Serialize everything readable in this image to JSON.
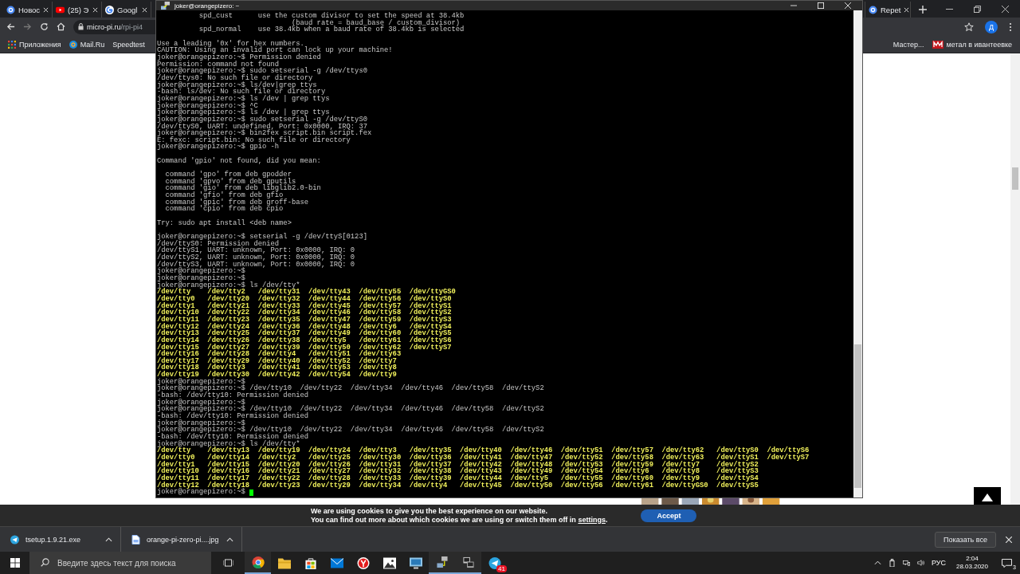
{
  "browser": {
    "tabs": [
      {
        "title": "Новос",
        "selected": false,
        "kind": "site"
      },
      {
        "title": "(25) Э",
        "selected": false,
        "kind": "video"
      },
      {
        "title": "Googl",
        "selected": false,
        "kind": "google"
      },
      {
        "title": "Repet",
        "selected": false,
        "kind": "site"
      }
    ],
    "url": {
      "host": "micro-pi.ru",
      "path": "/rpi-pi4"
    },
    "profile_initial": "Д",
    "bookmarks_left": [
      {
        "label": "Приложения",
        "kind": "apps"
      },
      {
        "label": "Mail.Ru",
        "kind": "mail"
      },
      {
        "label": "Speedtest",
        "kind": "plain"
      }
    ],
    "bookmarks_right": [
      {
        "label": "Мастер...",
        "kind": "plain"
      },
      {
        "label": "метал в ивантеевке",
        "kind": "logo"
      }
    ]
  },
  "cookie_bar": {
    "line1": "We are using cookies to give you the best experience on our website.",
    "line2": "You can find out more about which cookies we are using or switch them off in ",
    "link": "settings",
    "line2_end": ".",
    "button": "Accept"
  },
  "downloads": {
    "items": [
      {
        "name": "tsetup.1.9.21.exe",
        "kind": "telegram"
      },
      {
        "name": "orange-pi-zero-pi....jpg"
      }
    ],
    "show_all": "Показать все"
  },
  "terminal": {
    "title": "joker@orangepizero: ~",
    "cursor": true,
    "lines": [
      {
        "kind": "output",
        "text": "          spd_cust      use the custom divisor to set the speed at 38.4kb"
      },
      {
        "kind": "output",
        "text": "                                (baud rate = baud_base / custom_divisor)"
      },
      {
        "kind": "output",
        "text": "          spd_normal    use 38.4kb when a baud rate of 38.4kb is selected"
      },
      {
        "kind": "blank"
      },
      {
        "kind": "output",
        "text": "Use a leading '0x' for hex numbers."
      },
      {
        "kind": "output",
        "text": "CAUTION: Using an invalid port can lock up your machine!"
      },
      {
        "kind": "output",
        "text": "joker@orangepizero:~$ Permission denied"
      },
      {
        "kind": "output",
        "text": "Permission: command not found"
      },
      {
        "kind": "output",
        "text": "joker@orangepizero:~$ sudo setserial -g /dev/ttys0"
      },
      {
        "kind": "output",
        "text": "/dev/ttys0: No such file or directory"
      },
      {
        "kind": "output",
        "text": "joker@orangepizero:~$ ls/dev|grep ttys"
      },
      {
        "kind": "output",
        "text": "-bash: ls/dev: No such file or directory"
      },
      {
        "kind": "output",
        "text": "joker@orangepizero:~$ ls /dev | grep ttys"
      },
      {
        "kind": "output",
        "text": "joker@orangepizero:~$ ^C"
      },
      {
        "kind": "output",
        "text": "joker@orangepizero:~$ ls /dev | grep ttys"
      },
      {
        "kind": "output",
        "text": "joker@orangepizero:~$ sudo setserial -g /dev/ttyS0"
      },
      {
        "kind": "output",
        "text": "/dev/ttyS0, UART: undefined, Port: 0x0000, IRQ: 37"
      },
      {
        "kind": "output",
        "text": "joker@orangepizero:~$ bin2fex script.bin script.fex"
      },
      {
        "kind": "output",
        "text": "E: fexc: script.bin: No such file or directory"
      },
      {
        "kind": "output",
        "text": "joker@orangepizero:~$ gpio -h"
      },
      {
        "kind": "blank"
      },
      {
        "kind": "output",
        "text": "Command 'gpio' not found, did you mean:"
      },
      {
        "kind": "blank"
      },
      {
        "kind": "output",
        "text": "  command 'gpo' from deb gpodder"
      },
      {
        "kind": "output",
        "text": "  command 'gpvo' from deb gputils"
      },
      {
        "kind": "output",
        "text": "  command 'gio' from deb libglib2.0-bin"
      },
      {
        "kind": "output",
        "text": "  command 'gfio' from deb gfio"
      },
      {
        "kind": "output",
        "text": "  command 'gpic' from deb groff-base"
      },
      {
        "kind": "output",
        "text": "  command 'cpio' from deb cpio"
      },
      {
        "kind": "blank"
      },
      {
        "kind": "output",
        "text": "Try: sudo apt install <deb name>"
      },
      {
        "kind": "blank"
      },
      {
        "kind": "output",
        "text": "joker@orangepizero:~$ setserial -g /dev/ttyS[0123]"
      },
      {
        "kind": "output",
        "text": "/dev/ttyS0: Permission denied"
      },
      {
        "kind": "output",
        "text": "/dev/ttyS1, UART: unknown, Port: 0x0000, IRQ: 0"
      },
      {
        "kind": "output",
        "text": "/dev/ttyS2, UART: unknown, Port: 0x0000, IRQ: 0"
      },
      {
        "kind": "output",
        "text": "/dev/ttyS3, UART: unknown, Port: 0x0000, IRQ: 0"
      },
      {
        "kind": "output",
        "text": "joker@orangepizero:~$"
      },
      {
        "kind": "output",
        "text": "joker@orangepizero:~$"
      },
      {
        "kind": "output",
        "text": "joker@orangepizero:~$ ls /dev/tty*"
      },
      {
        "kind": "listing",
        "text": "/dev/tty    /dev/tty2   /dev/tty31  /dev/tty43  /dev/tty55  /dev/ttyGS0"
      },
      {
        "kind": "listing",
        "text": "/dev/tty0   /dev/tty20  /dev/tty32  /dev/tty44  /dev/tty56  /dev/ttyS0"
      },
      {
        "kind": "listing",
        "text": "/dev/tty1   /dev/tty21  /dev/tty33  /dev/tty45  /dev/tty57  /dev/ttyS1"
      },
      {
        "kind": "listing",
        "text": "/dev/tty10  /dev/tty22  /dev/tty34  /dev/tty46  /dev/tty58  /dev/ttyS2"
      },
      {
        "kind": "listing",
        "text": "/dev/tty11  /dev/tty23  /dev/tty35  /dev/tty47  /dev/tty59  /dev/ttyS3"
      },
      {
        "kind": "listing",
        "text": "/dev/tty12  /dev/tty24  /dev/tty36  /dev/tty48  /dev/tty6   /dev/ttyS4"
      },
      {
        "kind": "listing",
        "text": "/dev/tty13  /dev/tty25  /dev/tty37  /dev/tty49  /dev/tty60  /dev/ttyS5"
      },
      {
        "kind": "listing",
        "text": "/dev/tty14  /dev/tty26  /dev/tty38  /dev/tty5   /dev/tty61  /dev/ttyS6"
      },
      {
        "kind": "listing",
        "text": "/dev/tty15  /dev/tty27  /dev/tty39  /dev/tty50  /dev/tty62  /dev/ttyS7"
      },
      {
        "kind": "listing",
        "text": "/dev/tty16  /dev/tty28  /dev/tty4   /dev/tty51  /dev/tty63"
      },
      {
        "kind": "listing",
        "text": "/dev/tty17  /dev/tty29  /dev/tty40  /dev/tty52  /dev/tty7"
      },
      {
        "kind": "listing",
        "text": "/dev/tty18  /dev/tty3   /dev/tty41  /dev/tty53  /dev/tty8"
      },
      {
        "kind": "listing",
        "text": "/dev/tty19  /dev/tty30  /dev/tty42  /dev/tty54  /dev/tty9"
      },
      {
        "kind": "output",
        "text": "joker@orangepizero:~$"
      },
      {
        "kind": "output",
        "text": "joker@orangepizero:~$ /dev/tty10  /dev/tty22  /dev/tty34  /dev/tty46  /dev/tty58  /dev/ttyS2"
      },
      {
        "kind": "output",
        "text": "-bash: /dev/tty10: Permission denied"
      },
      {
        "kind": "output",
        "text": "joker@orangepizero:~$"
      },
      {
        "kind": "output",
        "text": "joker@orangepizero:~$ /dev/tty10  /dev/tty22  /dev/tty34  /dev/tty46  /dev/tty58  /dev/ttyS2"
      },
      {
        "kind": "output",
        "text": "-bash: /dev/tty10: Permission denied"
      },
      {
        "kind": "output",
        "text": "joker@orangepizero:~$"
      },
      {
        "kind": "output",
        "text": "joker@orangepizero:~$ /dev/tty10  /dev/tty22  /dev/tty34  /dev/tty46  /dev/tty58  /dev/ttyS2"
      },
      {
        "kind": "output",
        "text": "-bash: /dev/tty10: Permission denied"
      },
      {
        "kind": "output",
        "text": "joker@orangepizero:~$ ls /dev/tty*"
      },
      {
        "kind": "listing",
        "text": "/dev/tty    /dev/tty13  /dev/tty19  /dev/tty24  /dev/tty3   /dev/tty35  /dev/tty40  /dev/tty46  /dev/tty51  /dev/tty57  /dev/tty62   /dev/ttyS0  /dev/ttyS6"
      },
      {
        "kind": "listing",
        "text": "/dev/tty0   /dev/tty14  /dev/tty2   /dev/tty25  /dev/tty30  /dev/tty36  /dev/tty41  /dev/tty47  /dev/tty52  /dev/tty58  /dev/tty63   /dev/ttyS1  /dev/ttyS7"
      },
      {
        "kind": "listing",
        "text": "/dev/tty1   /dev/tty15  /dev/tty20  /dev/tty26  /dev/tty31  /dev/tty37  /dev/tty42  /dev/tty48  /dev/tty53  /dev/tty59  /dev/tty7    /dev/ttyS2"
      },
      {
        "kind": "listing",
        "text": "/dev/tty10  /dev/tty16  /dev/tty21  /dev/tty27  /dev/tty32  /dev/tty38  /dev/tty43  /dev/tty49  /dev/tty54  /dev/tty6   /dev/tty8    /dev/ttyS3"
      },
      {
        "kind": "listing",
        "text": "/dev/tty11  /dev/tty17  /dev/tty22  /dev/tty28  /dev/tty33  /dev/tty39  /dev/tty44  /dev/tty5   /dev/tty55  /dev/tty60  /dev/tty9    /dev/ttyS4"
      },
      {
        "kind": "listing",
        "text": "/dev/tty12  /dev/tty18  /dev/tty23  /dev/tty29  /dev/tty34  /dev/tty4   /dev/tty45  /dev/tty50  /dev/tty56  /dev/tty61  /dev/ttyGS0  /dev/ttyS5"
      },
      {
        "kind": "output",
        "text": "joker@orangepizero:~$ "
      }
    ]
  },
  "taskbar": {
    "search_placeholder": "Введите здесь текст для поиска",
    "telegram_badge": "41",
    "language": "РУС",
    "time": "2:04",
    "date": "28.03.2020",
    "notifications": "3"
  }
}
